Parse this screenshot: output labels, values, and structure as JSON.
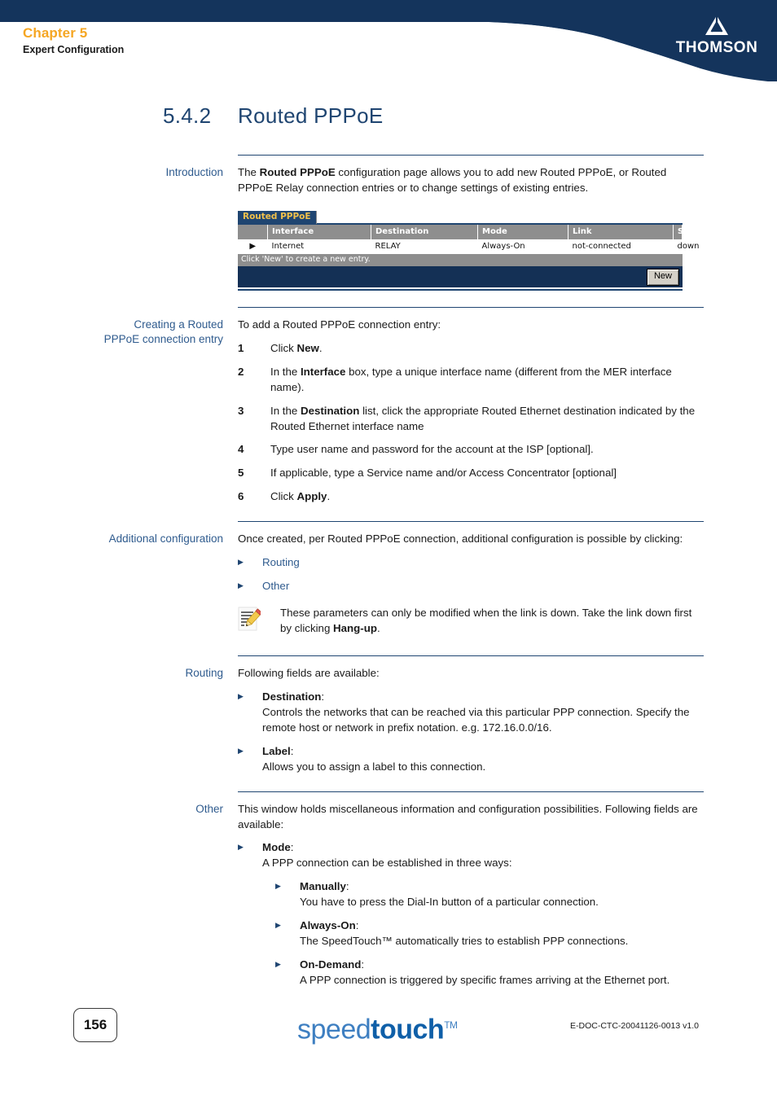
{
  "header": {
    "chapter": "Chapter 5",
    "subtitle": "Expert Configuration",
    "brand": "THOMSON"
  },
  "section": {
    "number": "5.4.2",
    "title": "Routed PPPoE"
  },
  "introduction": {
    "label": "Introduction",
    "text_1": "The ",
    "text_bold_1": "Routed PPPoE",
    "text_2": " configuration page allows you to add new Routed PPPoE, or Routed PPPoE Relay connection entries or to change settings of existing entries."
  },
  "screenshot": {
    "tab_label": "Routed PPPoE",
    "columns": [
      "",
      "Interface",
      "Destination",
      "Mode",
      "Link",
      "State"
    ],
    "rows": [
      {
        "marker": "▶",
        "interface": "Internet",
        "destination": "RELAY",
        "mode": "Always-On",
        "link": "not-connected",
        "state": "down"
      }
    ],
    "status_text": "Click 'New' to create a new entry.",
    "new_button": "New"
  },
  "creating": {
    "label_line1": "Creating a Routed",
    "label_line2": "PPPoE connection entry",
    "intro": "To add a Routed PPPoE connection entry:",
    "steps": [
      {
        "num": "1",
        "pre": "Click ",
        "bold": "New",
        "post": "."
      },
      {
        "num": "2",
        "pre": "In the ",
        "bold": "Interface",
        "post": " box, type a unique interface name (different from the MER interface name)."
      },
      {
        "num": "3",
        "pre": "In the ",
        "bold": "Destination",
        "post": " list, click the appropriate Routed Ethernet destination indicated by the Routed Ethernet interface name"
      },
      {
        "num": "4",
        "pre": "Type user name and password for the account at the ISP [optional].",
        "bold": "",
        "post": ""
      },
      {
        "num": "5",
        "pre": "If applicable, type a Service name and/or Access Concentrator [optional]",
        "bold": "",
        "post": ""
      },
      {
        "num": "6",
        "pre": "Click ",
        "bold": "Apply",
        "post": "."
      }
    ]
  },
  "additional": {
    "label": "Additional configuration",
    "intro": "Once created, per Routed PPPoE connection, additional configuration is possible by clicking:",
    "links": [
      "Routing",
      "Other"
    ],
    "note_pre": "These parameters can only be modified when the link is down. Take the link down first by clicking ",
    "note_bold": "Hang-up",
    "note_post": ".",
    "note_icon": "note-pencil-icon"
  },
  "routing": {
    "label": "Routing",
    "intro": "Following fields are available:",
    "fields": [
      {
        "name": "Destination",
        "colon": ":",
        "desc": "Controls the networks that can be reached via this particular PPP connection. Specify the remote host or network in prefix notation. e.g. 172.16.0.0/16."
      },
      {
        "name": "Label",
        "colon": ":",
        "desc": "Allows you to assign a label to this connection."
      }
    ]
  },
  "other": {
    "label": "Other",
    "intro": "This window holds miscellaneous information and configuration possibilities. Following fields are available:",
    "mode_name": "Mode",
    "mode_colon": ":",
    "mode_desc": "A PPP connection can be established in three ways:",
    "modes": [
      {
        "name": "Manually",
        "colon": ":",
        "desc": "You have to press the Dial-In button of a particular connection."
      },
      {
        "name": "Always-On",
        "colon": ":",
        "desc": "The SpeedTouch™ automatically tries to establish PPP connections."
      },
      {
        "name": "On-Demand",
        "colon": ":",
        "desc": "A PPP connection is triggered by specific frames arriving at the Ethernet port."
      }
    ]
  },
  "footer": {
    "page_number": "156",
    "logo_light": "speed",
    "logo_bold": "touch",
    "logo_tm": "TM",
    "doc_code": "E-DOC-CTC-20041126-0013 v1.0"
  },
  "colors": {
    "header_navy": "#14345C",
    "accent_orange": "#F5A623",
    "heading_blue": "#1F4571",
    "gutter_blue": "#2F5B8E",
    "widget_navy": "#143055",
    "widget_grey": "#8e8e8e",
    "tab_gold": "#F2C14B",
    "logo_blue": "#0F5FA8"
  }
}
